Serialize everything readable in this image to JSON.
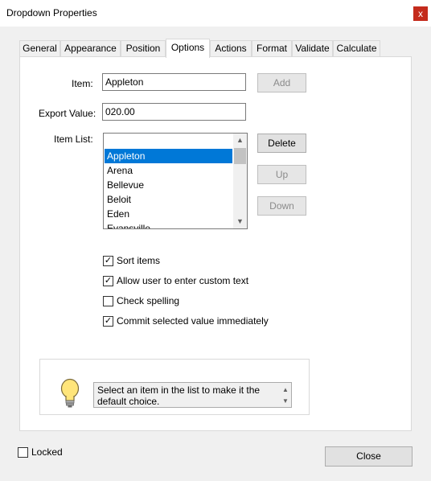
{
  "window": {
    "title": "Dropdown Properties",
    "close_glyph": "x"
  },
  "tabs": [
    {
      "label": "General"
    },
    {
      "label": "Appearance"
    },
    {
      "label": "Position"
    },
    {
      "label": "Options",
      "active": true
    },
    {
      "label": "Actions"
    },
    {
      "label": "Format"
    },
    {
      "label": "Validate"
    },
    {
      "label": "Calculate"
    }
  ],
  "options": {
    "item_label": "Item:",
    "item_value": "Appleton",
    "add_label": "Add",
    "export_label": "Export Value:",
    "export_value": "020.00",
    "list_label": "Item List:",
    "list_items": [
      "Appleton",
      "Arena",
      "Bellevue",
      "Beloit",
      "Eden",
      "Evansville"
    ],
    "selected_index": 0,
    "delete_label": "Delete",
    "up_label": "Up",
    "down_label": "Down"
  },
  "checkboxes": [
    {
      "label": "Sort items",
      "checked": true
    },
    {
      "label": "Allow user to enter custom text",
      "checked": true
    },
    {
      "label": "Check spelling",
      "checked": false
    },
    {
      "label": "Commit selected value immediately",
      "checked": true
    }
  ],
  "tip": {
    "text": "Select an item in the list to make it the default choice.",
    "icon": "lightbulb-icon"
  },
  "footer": {
    "locked_label": "Locked",
    "locked_checked": false,
    "close_label": "Close"
  },
  "colors": {
    "selection": "#0078d7",
    "close_x_bg": "#c42b1c",
    "panel_bg": "#ffffff",
    "dialog_bg": "#f0f0f0"
  }
}
